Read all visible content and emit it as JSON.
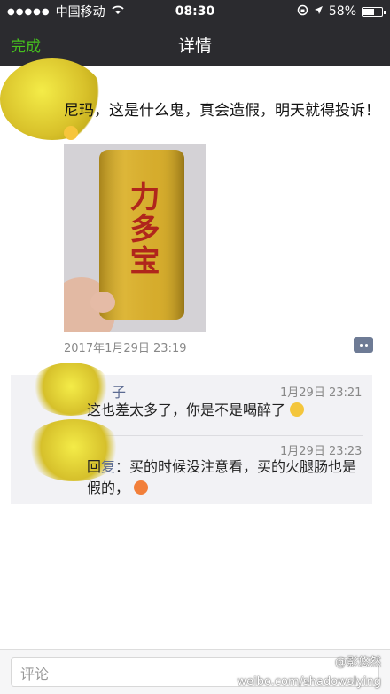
{
  "status_bar": {
    "carrier": "中国移动",
    "time": "08:30",
    "battery": "58%",
    "battery_level": 0.58
  },
  "nav": {
    "back_label": "完成",
    "title": "详情"
  },
  "post": {
    "text": "尼玛，这是什么鬼，真会造假，明天就得投诉！",
    "time": "2017年1月29日 23:19",
    "can_text": "力多宝"
  },
  "comments": [
    {
      "name_partial": "子",
      "time": "1月29日 23:21",
      "text": "这也差太多了，你是不是喝醉了"
    },
    {
      "time": "1月29日 23:23",
      "reply_prefix": "回",
      "reply_to": "复",
      "text": "：买的时候没注意看，买的火腿肠也是假的，"
    }
  ],
  "input": {
    "placeholder": "评论"
  },
  "watermark": {
    "handle": "@影悠然",
    "url": "weibo.com/shadowslying"
  }
}
